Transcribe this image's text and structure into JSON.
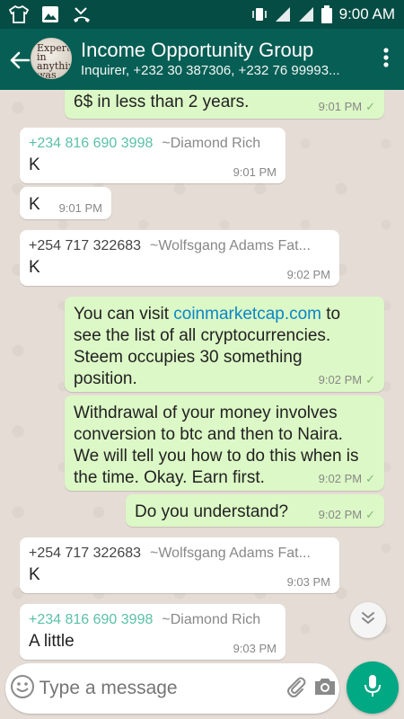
{
  "status_bar": {
    "time": "9:00 AM",
    "icons": [
      "shirt-icon",
      "image-icon",
      "missed-call-icon",
      "vibrate-icon",
      "signal-icon",
      "signal-icon",
      "battery-icon"
    ]
  },
  "header": {
    "title": "Income Opportunity Group",
    "subtitle": "Inquirer, +232 30 387306, +232 76 99993...",
    "avatar_text": "Expert in anything was once a beginner",
    "icons": [
      "back-arrow-icon",
      "more-vert-icon"
    ]
  },
  "messages": [
    {
      "dir": "out",
      "text": "6$ in less than 2 years.",
      "time": "9:01 PM",
      "tick": "✓"
    },
    {
      "dir": "in",
      "phone": "+234 816 690 3998",
      "name": "~Diamond Rich",
      "text": "K",
      "time": "9:01 PM"
    },
    {
      "dir": "in",
      "text": "K",
      "time": "9:01 PM"
    },
    {
      "dir": "in",
      "phone": "+254 717 322683",
      "name": "~Wolfsgang Adams Fat...",
      "text": "K",
      "time": "9:02 PM"
    },
    {
      "dir": "out",
      "text_before": "You can visit ",
      "link": "coinmarketcap.com",
      "text_after": " to see the list of all cryptocurrencies. Steem occupies 30 something position.",
      "time": "9:02 PM",
      "tick": "✓"
    },
    {
      "dir": "out",
      "text": "Withdrawal of your money involves conversion to btc and then to Naira. We will tell you how to do this when is the time. Okay. Earn first.",
      "time": "9:02 PM",
      "tick": "✓"
    },
    {
      "dir": "out",
      "text": "Do you understand?",
      "time": "9:02 PM",
      "tick": "✓"
    },
    {
      "dir": "in",
      "phone": "+254 717 322683",
      "name": "~Wolfsgang Adams Fat...",
      "text": "K",
      "time": "9:03 PM"
    },
    {
      "dir": "in",
      "phone": "+234 816 690 3998",
      "name": "~Diamond Rich",
      "text": "A little",
      "time": "9:03 PM"
    }
  ],
  "composer": {
    "placeholder": "Type a message",
    "icons": [
      "emoji-icon",
      "attach-icon",
      "camera-icon",
      "mic-icon"
    ]
  },
  "colors": {
    "app_bar": "#075e54",
    "status_bar": "#054d44",
    "outgoing_bubble": "#dcf8c6",
    "incoming_bubble": "#ffffff",
    "accent": "#00a884",
    "link": "#0a87c7"
  }
}
